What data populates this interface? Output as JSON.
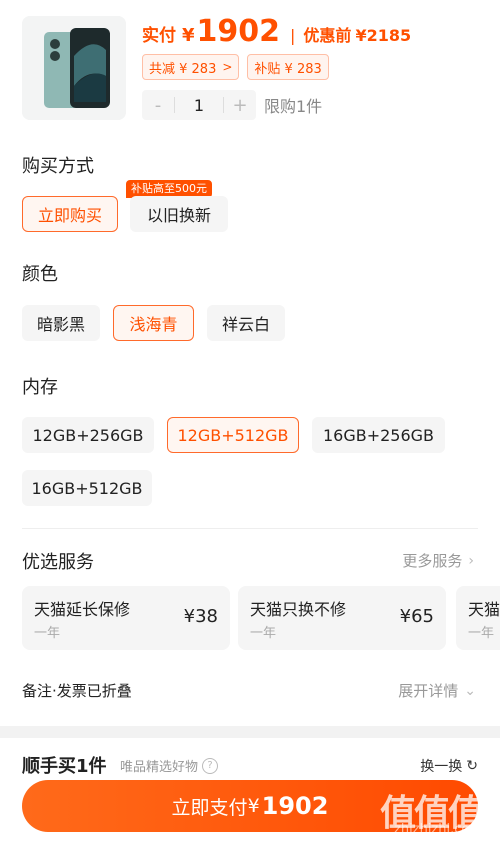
{
  "product": {
    "image_icon": "phone-image",
    "pay_label": "实付",
    "currency": "¥",
    "pay_amount": "1902",
    "separator": "|",
    "orig_label": "优惠前",
    "orig_price": "¥2185",
    "chips": [
      {
        "label": "共减 ¥ 283",
        "arrow": ">"
      },
      {
        "label": "补贴 ¥ 283"
      }
    ],
    "stepper": {
      "minus": "-",
      "qty": "1",
      "plus": "+"
    },
    "limit": "限购1件"
  },
  "purchase_method": {
    "title": "购买方式",
    "options": [
      "立即购买",
      "以旧换新"
    ],
    "selected_index": 0,
    "promo_tag": "补贴高至500元"
  },
  "color": {
    "title": "颜色",
    "options": [
      "暗影黑",
      "浅海青",
      "祥云白"
    ],
    "selected_index": 1
  },
  "storage": {
    "title": "内存",
    "options": [
      "12GB+256GB",
      "12GB+512GB",
      "16GB+256GB",
      "16GB+512GB"
    ],
    "selected_index": 1
  },
  "services": {
    "title": "优选服务",
    "more": "更多服务",
    "items": [
      {
        "name": "天猫延长保修",
        "term": "一年",
        "price": "¥38"
      },
      {
        "name": "天猫只换不修",
        "term": "一年",
        "price": "¥65"
      },
      {
        "name": "天猫",
        "term": "一年",
        "price": ""
      }
    ]
  },
  "notes": {
    "label": "备注·发票已折叠",
    "expand": "展开详情"
  },
  "bundle": {
    "title": "顺手买1件",
    "subtitle": "唯品精选好物",
    "swap": "换一换"
  },
  "pay_button": {
    "label": "立即支付",
    "currency": "¥",
    "amount": "1902"
  },
  "watermark": {
    "text": "值值值",
    "url": "zhizhizhi.com"
  },
  "colors": {
    "accent": "#ff5000",
    "selected_border": "#ff6a2b",
    "option_bg": "#f5f5f5"
  }
}
